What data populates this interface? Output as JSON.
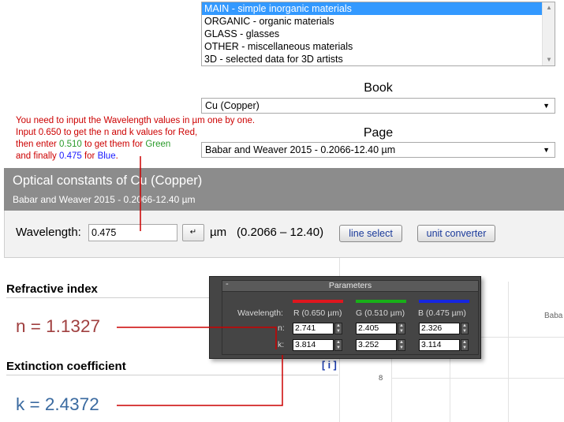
{
  "shelf": {
    "options": [
      "MAIN - simple inorganic materials",
      "ORGANIC - organic materials",
      "GLASS - glasses",
      "OTHER - miscellaneous materials",
      "3D - selected data for 3D artists"
    ],
    "selected_index": 0
  },
  "book": {
    "label": "Book",
    "value": "Cu (Copper)"
  },
  "page_select": {
    "label": "Page",
    "value": "Babar and Weaver 2015 - 0.2066-12.40 µm"
  },
  "annotation": {
    "line1": "You need to input the Wavelength values in µm one by one.",
    "line2": "Input 0.650 to get the n and k values for Red,",
    "line3_pre": "then enter ",
    "line3_val": "0.510",
    "line3_mid": " to get them for ",
    "line3_color": "Green",
    "line4_pre": "and finally ",
    "line4_val": "0.475",
    "line4_mid": " for ",
    "line4_color": "Blue",
    "line4_end": "."
  },
  "optical": {
    "title": "Optical constants of Cu (Copper)",
    "subtitle": "Babar and Weaver 2015 - 0.2066-12.40 µm"
  },
  "wavelength": {
    "label": "Wavelength:",
    "value": "0.475",
    "enter_icon": "↵",
    "unit": "µm",
    "range": "(0.2066 – 12.40)",
    "line_select": "line select",
    "unit_converter": "unit converter"
  },
  "results": {
    "refractive_title": "Refractive index",
    "n_value": "n = 1.1327",
    "extinction_title": "Extinction coefficient",
    "info": "[ i ]",
    "k_value": "k = 2.4372"
  },
  "chart": {
    "tick": "8",
    "legend": "Baba"
  },
  "parameters": {
    "title": "Parameters",
    "minus": "-",
    "wavelength_label": "Wavelength:",
    "n_label": "n:",
    "k_label": "k:",
    "columns": [
      {
        "label": "R (0.650 µm)",
        "color": "#e0161e",
        "n": "2.741",
        "k": "3.814"
      },
      {
        "label": "G (0.510 µm)",
        "color": "#18b018",
        "n": "2.405",
        "k": "3.252"
      },
      {
        "label": "B (0.475 µm)",
        "color": "#1626e0",
        "n": "2.326",
        "k": "3.114"
      }
    ]
  },
  "colors": {
    "annotation": "#cc0000",
    "header_bg": "#8c8c8c",
    "n_color": "#a04040",
    "k_color": "#3a6aa0",
    "selection": "#3399ff"
  }
}
